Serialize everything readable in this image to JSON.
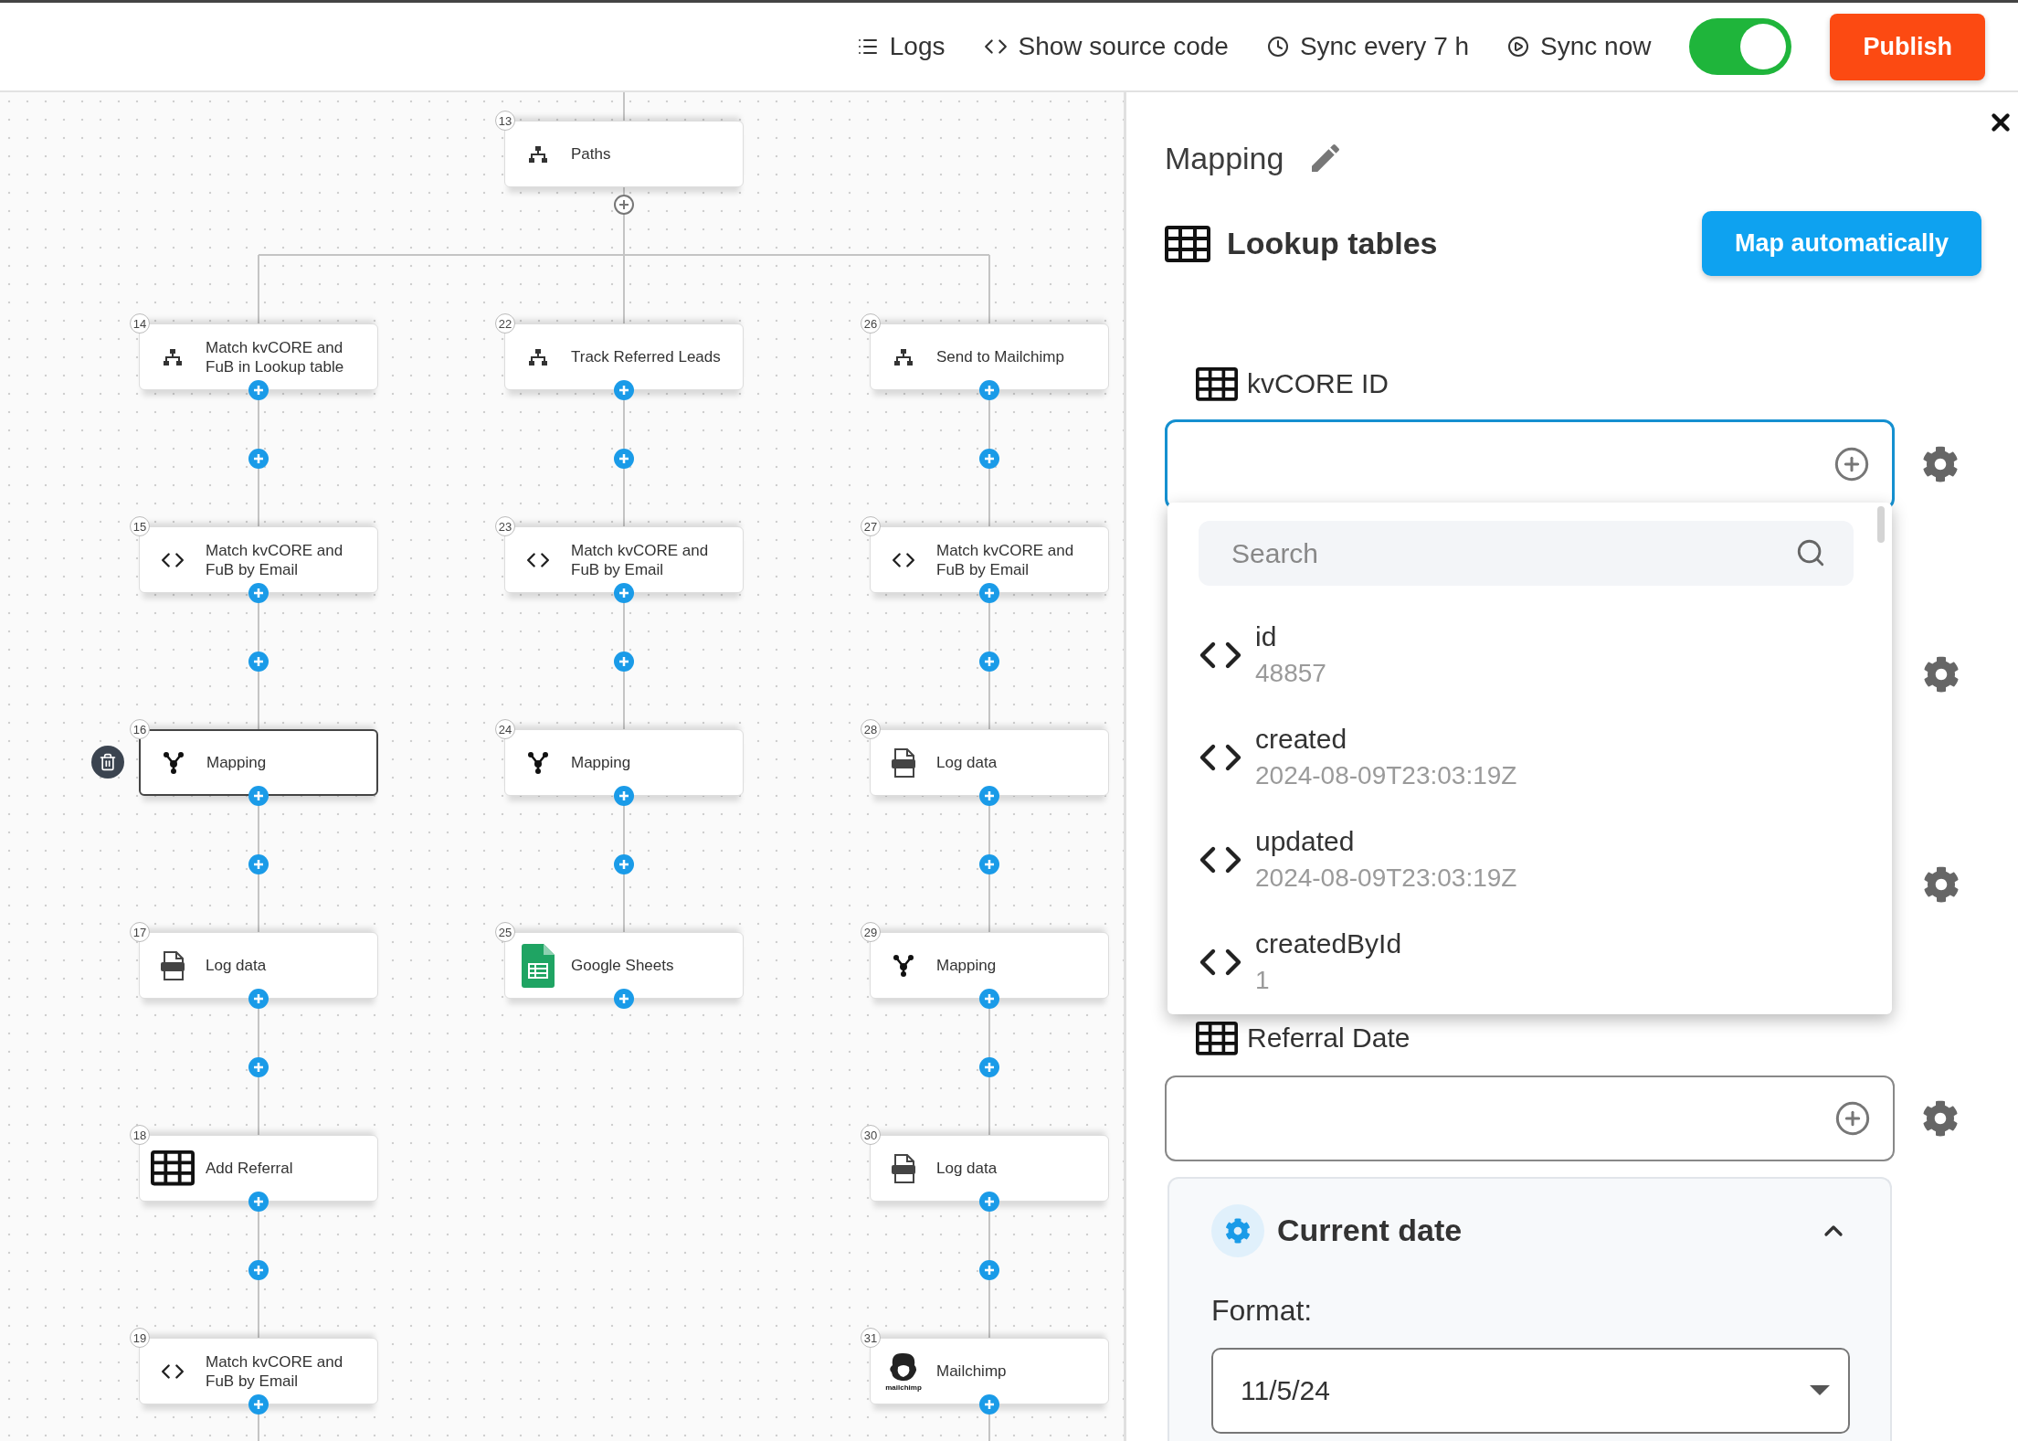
{
  "toolbar": {
    "actions": [
      {
        "kind": "logs",
        "label": "Logs"
      },
      {
        "kind": "source",
        "label": "Show source code"
      },
      {
        "kind": "schedule",
        "label": "Sync every 7 h"
      },
      {
        "kind": "run",
        "label": "Sync now"
      }
    ],
    "sync_enabled": true,
    "publish": "Publish"
  },
  "flow": {
    "root": {
      "number": "13",
      "title": "Paths",
      "kind": "paths",
      "selected": false
    },
    "branches": [
      {
        "nodes": [
          {
            "number": "14",
            "title": "Match kvCORE and FuB in Lookup table",
            "kind": "paths",
            "selected": false
          },
          {
            "number": "15",
            "title": "Match kvCORE and FuB by Email",
            "kind": "code",
            "selected": false
          },
          {
            "number": "16",
            "title": "Mapping",
            "kind": "mapping",
            "selected": true
          },
          {
            "number": "17",
            "title": "Log data",
            "kind": "log",
            "selected": false
          },
          {
            "number": "18",
            "title": "Add Referral",
            "kind": "table",
            "selected": false
          },
          {
            "number": "19",
            "title": "Match kvCORE and FuB by Email",
            "kind": "code",
            "selected": false
          }
        ]
      },
      {
        "nodes": [
          {
            "number": "22",
            "title": "Track Referred Leads",
            "kind": "paths",
            "selected": false
          },
          {
            "number": "23",
            "title": "Match kvCORE and FuB by Email",
            "kind": "code",
            "selected": false
          },
          {
            "number": "24",
            "title": "Mapping",
            "kind": "mapping",
            "selected": false
          },
          {
            "number": "25",
            "title": "Google Sheets",
            "kind": "sheets",
            "selected": false
          }
        ]
      },
      {
        "nodes": [
          {
            "number": "26",
            "title": "Send to Mailchimp",
            "kind": "paths",
            "selected": false
          },
          {
            "number": "27",
            "title": "Match kvCORE and FuB by Email",
            "kind": "code",
            "selected": false
          },
          {
            "number": "28",
            "title": "Log data",
            "kind": "log",
            "selected": false
          },
          {
            "number": "29",
            "title": "Mapping",
            "kind": "mapping",
            "selected": false
          },
          {
            "number": "30",
            "title": "Log data",
            "kind": "log",
            "selected": false
          },
          {
            "number": "31",
            "title": "Mailchimp",
            "kind": "mascot",
            "icon_caption": "mailchimp",
            "selected": false
          }
        ]
      }
    ]
  },
  "panel": {
    "title": "Mapping",
    "section": "Lookup tables",
    "auto_button": "Map automatically",
    "fields": [
      {
        "kind": "field",
        "label": "kvCORE ID",
        "focused": true
      },
      {
        "kind": "covered"
      },
      {
        "kind": "covered"
      },
      {
        "kind": "field",
        "label": "Referral Date",
        "focused": false
      }
    ],
    "dropdown": {
      "placeholder": "Search",
      "items": [
        {
          "name": "id",
          "value": "48857"
        },
        {
          "name": "created",
          "value": "2024-08-09T23:03:19Z"
        },
        {
          "name": "updated",
          "value": "2024-08-09T23:03:19Z"
        },
        {
          "name": "createdById",
          "value": "1"
        }
      ]
    },
    "transform": {
      "title": "Current date",
      "expanded": true,
      "format_label": "Format:",
      "format_value": "11/5/24"
    }
  }
}
